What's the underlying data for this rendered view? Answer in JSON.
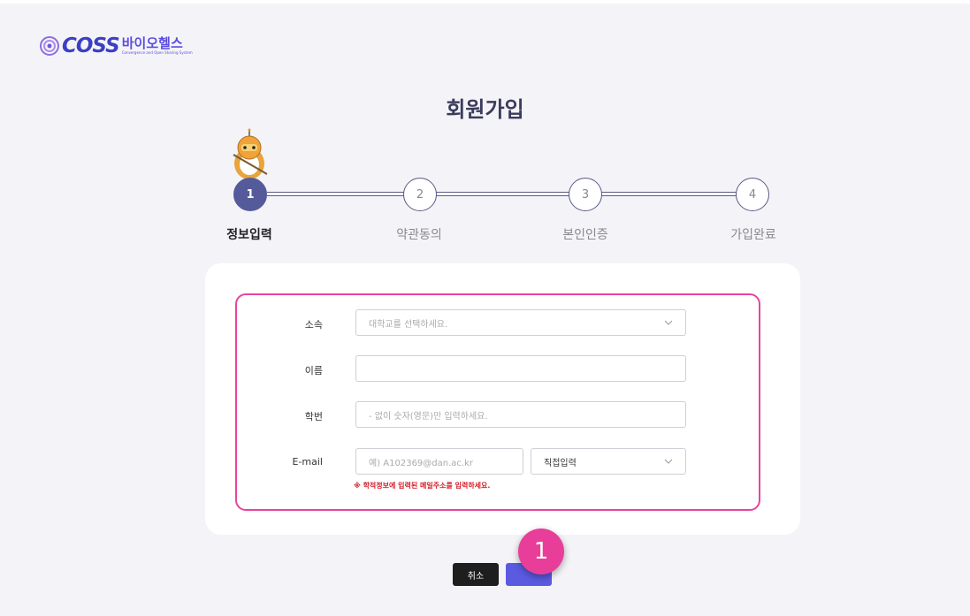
{
  "logo": {
    "brand": "COSS",
    "brand_kr": "바이오헬스",
    "tagline": "Convergence and Open Sharing System"
  },
  "page_title": "회원가입",
  "steps": [
    {
      "number": "1",
      "label": "정보입력",
      "active": true
    },
    {
      "number": "2",
      "label": "약관동의",
      "active": false
    },
    {
      "number": "3",
      "label": "본인인증",
      "active": false
    },
    {
      "number": "4",
      "label": "가입완료",
      "active": false
    }
  ],
  "form": {
    "affiliation": {
      "label": "소속",
      "placeholder": "대학교를 선택하세요."
    },
    "name": {
      "label": "이름",
      "value": ""
    },
    "student_id": {
      "label": "학번",
      "placeholder": "- 없이 숫자(영문)만 입력하세요."
    },
    "email": {
      "label": "E-mail",
      "placeholder": "예) A102369@dan.ac.kr",
      "domain_select": "직접입력",
      "notice": "※ 학적정보에 입력된 메일주소를 입력하세요."
    }
  },
  "buttons": {
    "cancel": "취소",
    "next": ""
  },
  "annotation_badge": "1",
  "colors": {
    "accent": "#5b5be2",
    "highlight": "#e8449e",
    "active_step": "#555a9a",
    "notice": "#d21f2a"
  }
}
